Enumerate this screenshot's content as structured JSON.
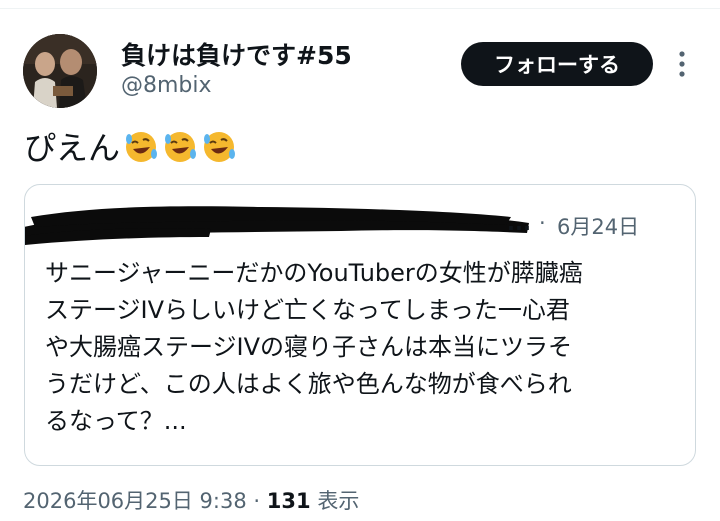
{
  "author": {
    "display_name": "負けは負けです#55",
    "handle": "@8mbix"
  },
  "follow_label": "フォローする",
  "tweet_text": "ぴえん",
  "tweet_emojis": [
    "rolling-on-floor-laughing",
    "rolling-on-floor-laughing",
    "rolling-on-floor-laughing"
  ],
  "quote": {
    "author_trailing": "...",
    "separator": "·",
    "date": "6月24日",
    "lines": [
      "サニージャーニーだかのYouTuberの女性が膵臓癌",
      "ステージIVらしいけど亡くなってしまった一心君",
      "や大腸癌ステージIVの寝り子さんは本当にツラそ",
      "うだけど、この人はよく旅や色んな物が食べられ",
      "るなって？..."
    ]
  },
  "meta": {
    "timestamp": "2026年06月25日 9:38",
    "separator": "·",
    "view_count": "131",
    "view_label": "表示"
  },
  "colors": {
    "text": "#0f1419",
    "secondary": "#536471",
    "border": "#cfd9de",
    "follow_bg": "#0f1419"
  }
}
